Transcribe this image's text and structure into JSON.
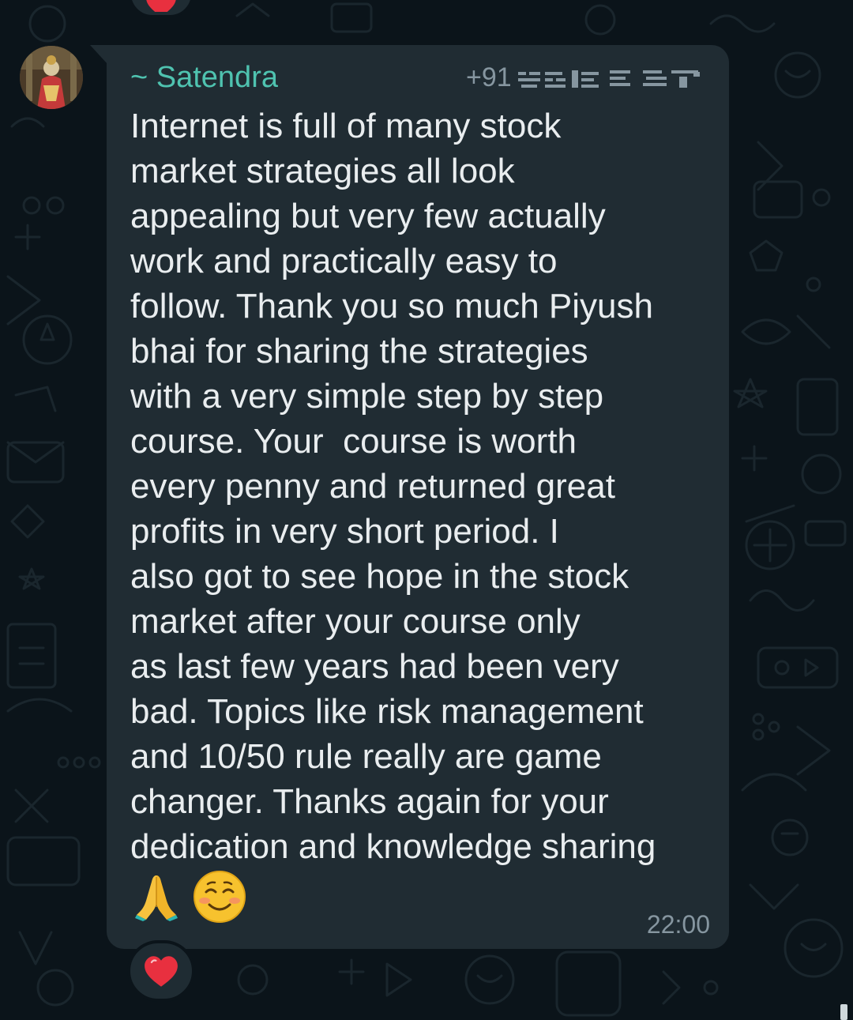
{
  "chat": {
    "message": {
      "sender": "~ Satendra",
      "phone_prefix": "+91",
      "lines": [
        "Internet is full of many stock",
        "market strategies all look",
        "appealing but very few actually",
        "work and practically easy to",
        "follow. Thank you so much Piyush",
        "bhai for sharing the strategies",
        "with a very simple step by step",
        "course. Your  course is worth",
        "every penny and returned great",
        "profits in very short period. I",
        "also got to see hope in the stock",
        "market after your course only",
        "as last few years had been very",
        "bad. Topics like risk management",
        "and 10/50 rule really are game",
        "changer. Thanks again for your",
        "dedication and knowledge sharing"
      ],
      "emojis": [
        "folded-hands-icon",
        "smiling-face-icon"
      ],
      "time": "22:00",
      "reaction": "heart-icon"
    },
    "previous_message": {
      "reaction": "heart-icon"
    },
    "colors": {
      "background": "#0b141a",
      "bubble": "#202c33",
      "sender_name": "#4fc3b0",
      "text": "#e9edef",
      "meta": "#8696a0",
      "heart": "#e8303f"
    }
  }
}
